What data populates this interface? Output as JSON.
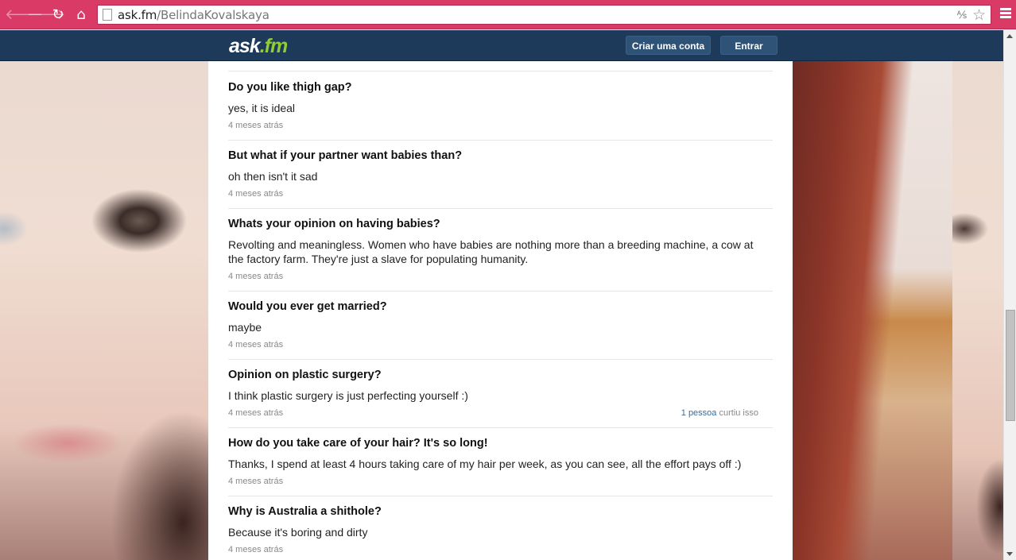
{
  "browser": {
    "url_host": "ask.fm",
    "url_path": "/BelindaKovalskaya",
    "back_glyph": "🡐",
    "forward_glyph": "🡒",
    "reload_glyph": "↻",
    "home_glyph": "⌂",
    "translate_glyph": "⅍",
    "star_glyph": "☆"
  },
  "header": {
    "logo_main": "ask",
    "logo_dot": ".",
    "logo_fm": "fm",
    "create_account": "Criar uma conta",
    "login": "Entrar"
  },
  "colors": {
    "chrome": "#d93a66",
    "topbar": "#1e3a5a",
    "logo_accent": "#8fce33",
    "link": "#3c6a96"
  },
  "answers": [
    {
      "question": "Do you like thigh gap?",
      "answer": "yes, it is ideal",
      "time": "4 meses atrás"
    },
    {
      "question": "But what if your partner want babies than?",
      "answer": "oh then isn't it sad",
      "time": "4 meses atrás"
    },
    {
      "question": "Whats your opinion on having babies?",
      "answer": "Revolting and meaningless. Women who have babies are nothing more than a breeding machine, a cow at the factory farm. They're just a slave for populating humanity.",
      "time": "4 meses atrás"
    },
    {
      "question": "Would you ever get married?",
      "answer": "maybe",
      "time": "4 meses atrás"
    },
    {
      "question": "Opinion on plastic surgery?",
      "answer": "I think plastic surgery is just perfecting yourself :)",
      "time": "4 meses atrás",
      "likes_who": "1 pessoa",
      "likes_rest": " curtiu isso"
    },
    {
      "question": "How do you take care of your hair? It's so long!",
      "answer": "Thanks, I spend at least 4 hours taking care of my hair per week, as you can see, all the effort pays off :)",
      "time": "4 meses atrás"
    },
    {
      "question": "Why is Australia a shithole?",
      "answer": "Because it's boring and dirty",
      "time": "4 meses atrás"
    }
  ]
}
